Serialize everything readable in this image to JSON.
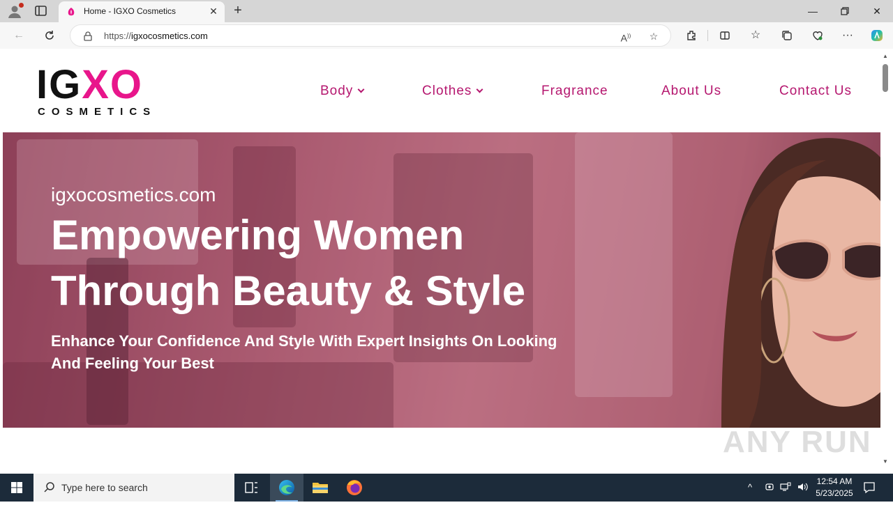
{
  "browser": {
    "tab_title": "Home - IGXO Cosmetics",
    "url_prefix": "https://",
    "url_domain": "igxocosmetics.com"
  },
  "site": {
    "logo_igx": "IGX",
    "logo_o": "O",
    "logo_ig": "IG",
    "logo_xo": "XO",
    "logo_sub": "COSMETICS",
    "nav": [
      {
        "label": "Body",
        "has_dropdown": true
      },
      {
        "label": "Clothes",
        "has_dropdown": true
      },
      {
        "label": "Fragrance",
        "has_dropdown": false
      },
      {
        "label": "About Us",
        "has_dropdown": false
      },
      {
        "label": "Contact Us",
        "has_dropdown": false
      }
    ],
    "brand_color": "#e8168b",
    "nav_color": "#b5176f"
  },
  "hero": {
    "domain": "igxocosmetics.com",
    "title_line1": "Empowering Women",
    "title_line2": "Through Beauty & Style",
    "subtitle_line1": "Enhance Your Confidence And Style With Expert Insights On Looking",
    "subtitle_line2": "And Feeling Your Best"
  },
  "watermark": "ANY RUN",
  "taskbar": {
    "search_placeholder": "Type here to search",
    "time": "12:54 AM",
    "date": "5/23/2025"
  }
}
